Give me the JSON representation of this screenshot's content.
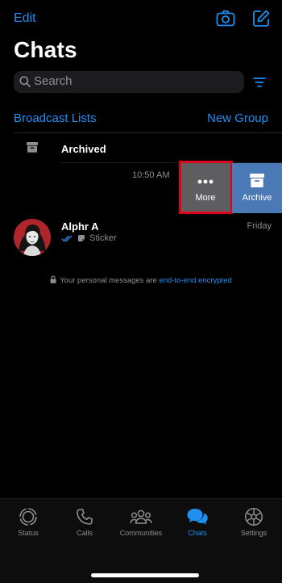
{
  "header": {
    "edit_label": "Edit",
    "title": "Chats"
  },
  "search": {
    "placeholder": "Search"
  },
  "links": {
    "broadcast": "Broadcast Lists",
    "new_group": "New Group"
  },
  "archived": {
    "label": "Archived"
  },
  "swiped_row": {
    "time": "10:50 AM",
    "more_label": "More",
    "archive_label": "Archive"
  },
  "chats": [
    {
      "name": "Alphr A",
      "date": "Friday",
      "preview": "Sticker"
    }
  ],
  "encryption": {
    "text": "Your personal messages are ",
    "link": "end-to-end encrypted"
  },
  "tabs": [
    {
      "label": "Status",
      "icon": "status-icon"
    },
    {
      "label": "Calls",
      "icon": "calls-icon"
    },
    {
      "label": "Communities",
      "icon": "communities-icon"
    },
    {
      "label": "Chats",
      "icon": "chats-icon",
      "active": true
    },
    {
      "label": "Settings",
      "icon": "settings-icon"
    }
  ],
  "colors": {
    "accent": "#1f8ff0",
    "more_bg": "#5e5e61",
    "archive_bg": "#4b79b5",
    "highlight": "#e1001a"
  }
}
